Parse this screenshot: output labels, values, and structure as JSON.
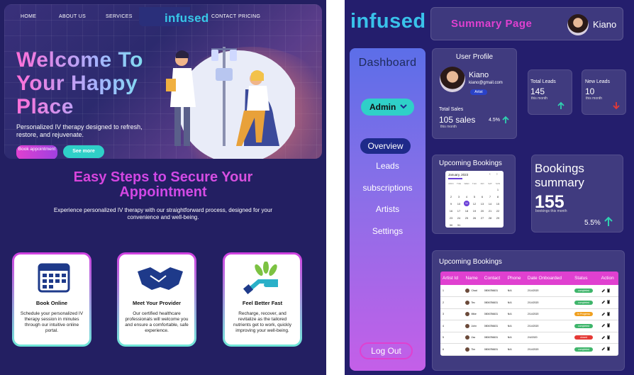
{
  "landing": {
    "nav": {
      "home": "HOME",
      "about": "ABOUT US",
      "services": "SERVICES",
      "brand": "infused",
      "contact": "CONTACT",
      "pricing": "PRICING"
    },
    "hero": {
      "title": "Welcome To Your Happy Place",
      "text": "Personalized IV therapy designed to refresh, restore, and rejuvenate.",
      "cta_book": "Book appointment",
      "cta_more": "See more"
    },
    "steps": {
      "title": "Easy Steps to Secure Your Appointment",
      "subtitle": "Experience personalized IV therapy with our straightforward process, designed for your convenience and well-being.",
      "cards": [
        {
          "title": "Book Online",
          "text": "Schedule your personalized IV therapy session in minutes through our intuitive online portal.",
          "icon": "calendar-icon"
        },
        {
          "title": "Meet Your Provider",
          "text": "Our certified healthcare professionals will welcome you and ensure a comfortable, safe experience.",
          "icon": "handshake-icon"
        },
        {
          "title": "Feel Better Fast",
          "text": "Recharge, recover, and revitalize as the tailored nutrients get to work, quickly improving your well-being.",
          "icon": "hand-leaves-icon"
        }
      ]
    }
  },
  "dashboard": {
    "brand": "infused",
    "header": {
      "title": "Summary Page",
      "user": "Kiano"
    },
    "sidebar": {
      "title": "Dashboard",
      "role": "Admin",
      "items": [
        "Overview",
        "Leads",
        "subscriptions",
        "Artists",
        "Settings"
      ],
      "active": "Overview",
      "logout": "Log Out"
    },
    "profile": {
      "heading": "User Profile",
      "name": "Kiano",
      "email": "kiano@gmail.com",
      "badge": "Artist",
      "sales_label": "Total Sales",
      "sales_value": "105 sales",
      "sales_sub": "this month",
      "sales_pct": "4.5%"
    },
    "total_leads": {
      "label": "Total Leads",
      "value": "145",
      "sub": "this month"
    },
    "new_leads": {
      "label": "New Leads",
      "value": "10",
      "sub": "this month"
    },
    "upcoming": {
      "heading": "Upcoming Bookings",
      "month": "January, 2023",
      "weekdays": [
        "MON",
        "TUE",
        "WED",
        "THU",
        "FRI",
        "SAT",
        "SUN"
      ],
      "days": [
        "",
        "",
        "",
        "",
        "",
        "",
        "1",
        "2",
        "3",
        "4",
        "5",
        "6",
        "7",
        "8",
        "9",
        "10",
        "11",
        "12",
        "13",
        "14",
        "15",
        "16",
        "17",
        "18",
        "19",
        "20",
        "21",
        "22",
        "23",
        "24",
        "25",
        "26",
        "27",
        "28",
        "29",
        "30",
        "31"
      ],
      "selected": "11"
    },
    "summary": {
      "title": "Bookings summary",
      "value": "155",
      "sub": "bookings this month",
      "pct": "5.5%"
    },
    "table": {
      "heading": "Upcoming Bookings",
      "columns": [
        "Artist Id",
        "Name",
        "Contact",
        "Phone",
        "Date Onboarded",
        "Status",
        "Action"
      ],
      "rows": [
        {
          "id": "1",
          "name": "Chad",
          "contact": "0806786631",
          "phone": "N/A",
          "date": "2/14/2020",
          "status": "completed",
          "color": "#3fb56b"
        },
        {
          "id": "2",
          "name": "Tec",
          "contact": "0806786631",
          "phone": "N/A",
          "date": "2/14/2020",
          "status": "completed",
          "color": "#3fb56b"
        },
        {
          "id": "3",
          "name": "Mike",
          "contact": "0806786631",
          "phone": "N/A",
          "date": "2/14/2020",
          "status": "In Progress",
          "color": "#f0a020"
        },
        {
          "id": "4",
          "name": "John",
          "contact": "0806786631",
          "phone": "N/A",
          "date": "2/14/2020",
          "status": "completed",
          "color": "#3fb56b"
        },
        {
          "id": "5",
          "name": "Zac",
          "contact": "0806786631",
          "phone": "N/A",
          "date": "2/4/2020",
          "status": "closed",
          "color": "#e53935"
        },
        {
          "id": "6",
          "name": "Tim",
          "contact": "0806786631",
          "phone": "N/A",
          "date": "2/14/2020",
          "status": "completed",
          "color": "#3fb56b"
        }
      ]
    }
  }
}
